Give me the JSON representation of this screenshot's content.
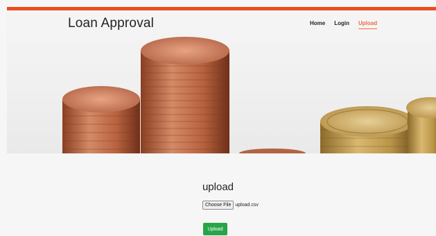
{
  "brand": {
    "title": "Loan Approval"
  },
  "nav": {
    "home": "Home",
    "login": "Login",
    "upload": "Upload"
  },
  "main": {
    "heading": "upload",
    "choose_file_label": "Choose File",
    "selected_file": "upload.csv",
    "upload_button": "Upload"
  },
  "colors": {
    "accent": "#ee4b1f",
    "nav_active": "#ee6a44",
    "button": "#27a548"
  }
}
